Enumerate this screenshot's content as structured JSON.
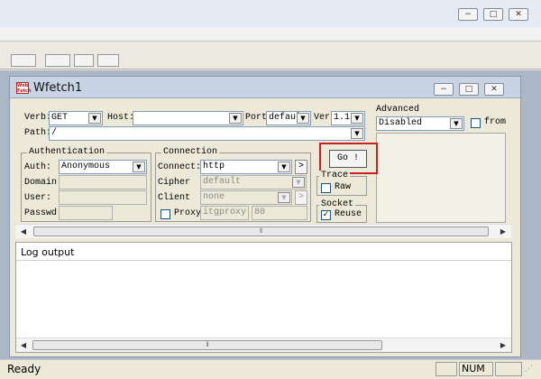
{
  "window": {
    "title": "Wfetch1",
    "logo_text": "Web Fetch"
  },
  "controls": {
    "minimize": "−",
    "maximize": "□",
    "close": "✕"
  },
  "request": {
    "verb_label": "Verb:",
    "verb_value": "GET",
    "host_label": "Host:",
    "host_value": "",
    "port_label": "Port",
    "port_value": "defaul",
    "ver_label": "Ver:",
    "ver_value": "1.1",
    "path_label": "Path:",
    "path_value": "/"
  },
  "advanced": {
    "title": "Advanced",
    "value": "Disabled",
    "from_label": "from"
  },
  "authentication": {
    "title": "Authentication",
    "auth_label": "Auth:",
    "auth_value": "Anonymous",
    "domain_label": "Domain:",
    "user_label": "User:",
    "passwd_label": "Passwd:"
  },
  "connection": {
    "title": "Connection",
    "connect_label": "Connect:",
    "connect_value": "http",
    "connect_more": ">",
    "cipher_label": "Cipher",
    "cipher_value": "default",
    "client_label": "Client",
    "client_value": "none",
    "client_more": ">",
    "proxy_label": "Proxy",
    "proxy_host": "itgproxy",
    "proxy_port": "80"
  },
  "go_button": "Go !",
  "trace": {
    "title": "Trace",
    "raw_label": "Raw"
  },
  "socket": {
    "title": "Socket",
    "reuse_label": "Reuse"
  },
  "log": {
    "title": "Log output"
  },
  "status": {
    "text": "Ready",
    "num": "NUM"
  },
  "colors": {
    "highlight": "#cc1f1f",
    "title_bg": "#c8d4e4"
  }
}
